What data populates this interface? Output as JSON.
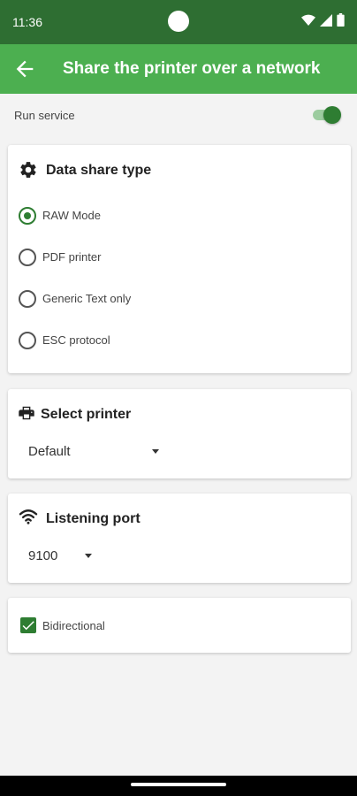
{
  "status_bar": {
    "time": "11:36"
  },
  "app_bar": {
    "title": "Share the printer over a network"
  },
  "run_service": {
    "label": "Run service",
    "enabled": true
  },
  "data_share_type": {
    "title": "Data share type",
    "options": [
      {
        "label": "RAW Mode",
        "selected": true
      },
      {
        "label": "PDF printer",
        "selected": false
      },
      {
        "label": "Generic Text only",
        "selected": false
      },
      {
        "label": "ESC protocol",
        "selected": false
      }
    ]
  },
  "select_printer": {
    "title": "Select printer",
    "value": "Default"
  },
  "listening_port": {
    "title": "Listening port",
    "value": "9100"
  },
  "bidirectional": {
    "label": "Bidirectional",
    "checked": true
  },
  "colors": {
    "status_bar": "#2e6e32",
    "app_bar": "#4caf50",
    "accent": "#2e7d32",
    "background": "#f3f3f3"
  }
}
